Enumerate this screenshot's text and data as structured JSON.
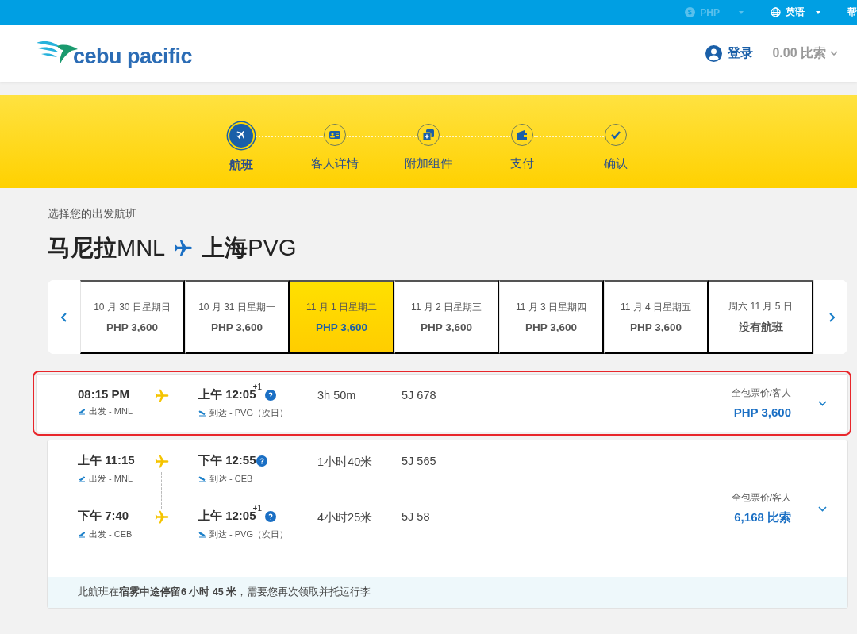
{
  "top_bar": {
    "currency": {
      "label": "PHP",
      "disabled": true
    },
    "language": "英语",
    "help": "帮"
  },
  "header": {
    "brand": "cebu pacific",
    "login": "登录",
    "balance": "0.00 比索"
  },
  "steps": [
    {
      "label": "航班",
      "selected": true
    },
    {
      "label": "客人详情",
      "selected": false
    },
    {
      "label": "附加组件",
      "selected": false
    },
    {
      "label": "支付",
      "selected": false
    },
    {
      "label": "确认",
      "selected": false
    }
  ],
  "subtitle": "选择您的出发航班",
  "route": {
    "origin_city": "马尼拉",
    "origin_code": "MNL",
    "destination_city": "上海",
    "destination_code": "PVG"
  },
  "dates": [
    {
      "date": "10 月 30 日星期日",
      "price": "PHP 3,600",
      "selected": false
    },
    {
      "date": "10 月 31 日星期一",
      "price": "PHP 3,600",
      "selected": false
    },
    {
      "date": "11 月 1 日星期二",
      "price": "PHP 3,600",
      "selected": true
    },
    {
      "date": "11 月 2 日星期三",
      "price": "PHP 3,600",
      "selected": false
    },
    {
      "date": "11 月 3 日星期四",
      "price": "PHP 3,600",
      "selected": false
    },
    {
      "date": "11 月 4 日星期五",
      "price": "PHP 3,600",
      "selected": false
    },
    {
      "date": "周六 11 月 5 日",
      "price": "没有航班",
      "selected": false
    }
  ],
  "flights": [
    {
      "highlighted": true,
      "price_label": "全包票价/客人",
      "price": "PHP 3,600",
      "legs": [
        {
          "depart_time": "08:15 PM",
          "depart_label": "出发 - MNL",
          "arrive_time": "上午 12:05",
          "plus_days": "+1",
          "arrive_label": "到达 - PVG（次日）",
          "duration": "3h 50m",
          "flight_no": "5J 678"
        }
      ]
    },
    {
      "highlighted": false,
      "price_label": "全包票价/客人",
      "price": "6,168 比索",
      "note": "此航班在**宿雾中途停留6 小时 45 米**，需要您再次领取并托运行李",
      "legs": [
        {
          "depart_time": "上午 11:15",
          "depart_label": "出发 - MNL",
          "arrive_time": "下午 12:55",
          "arrive_label": "到达 - CEB",
          "duration": "1小时40米",
          "flight_no": "5J 565"
        },
        {
          "depart_time": "下午 7:40",
          "depart_label": "出发 - CEB",
          "arrive_time": "上午 12:05",
          "plus_days": "+1",
          "arrive_label": "到达 - PVG（次日）",
          "duration": "4小时25米",
          "flight_no": "5J 58"
        }
      ]
    }
  ]
}
